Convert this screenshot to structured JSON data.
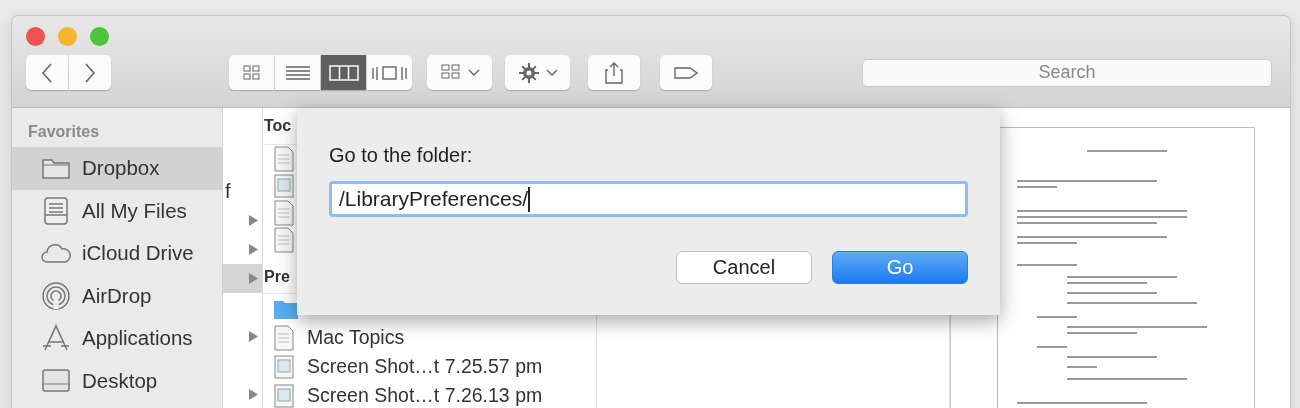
{
  "toolbar": {
    "view_modes": [
      {
        "kind": "icons",
        "selected": false
      },
      {
        "kind": "list",
        "selected": false
      },
      {
        "kind": "columns",
        "selected": true
      },
      {
        "kind": "coverflow",
        "selected": false
      }
    ],
    "search": {
      "placeholder": "Search"
    }
  },
  "sidebar": {
    "heading": "Favorites",
    "items": [
      {
        "label": "Dropbox",
        "kind": "folder",
        "selected": true
      },
      {
        "label": "All My Files",
        "kind": "files",
        "selected": false
      },
      {
        "label": "iCloud Drive",
        "kind": "cloud",
        "selected": false
      },
      {
        "label": "AirDrop",
        "kind": "airdrop",
        "selected": false
      },
      {
        "label": "Applications",
        "kind": "apps",
        "selected": false
      },
      {
        "label": "Desktop",
        "kind": "desktop",
        "selected": false
      }
    ]
  },
  "column_1": {
    "rows": [
      {
        "label": "f",
        "expandable": false,
        "selected": false
      },
      {
        "expandable": true,
        "selected": false
      },
      {
        "expandable": true,
        "selected": false
      },
      {
        "expandable": true,
        "selected": true
      },
      {
        "expandable": false,
        "selected": false
      },
      {
        "expandable": true,
        "selected": false
      },
      {
        "expandable": false,
        "selected": false
      },
      {
        "expandable": true,
        "selected": false
      }
    ]
  },
  "column_2": {
    "sections": [
      {
        "heading": "Toc",
        "rows": [
          {
            "kind": "document"
          },
          {
            "kind": "image"
          },
          {
            "kind": "document"
          },
          {
            "kind": "document"
          }
        ]
      },
      {
        "heading": "Pre",
        "rows": [
          {
            "kind": "folder"
          },
          {
            "kind": "document",
            "label": "Mac Topics"
          },
          {
            "kind": "image",
            "label": "Screen Shot…t 7.25.57 pm"
          },
          {
            "kind": "image",
            "label": "Screen Shot…t 7.26.13 pm"
          }
        ]
      }
    ]
  },
  "dialog": {
    "prompt": "Go to the folder:",
    "path": "/LibraryPreferences/",
    "buttons": [
      {
        "label": "Cancel",
        "default": false
      },
      {
        "label": "Go",
        "default": true
      }
    ]
  }
}
